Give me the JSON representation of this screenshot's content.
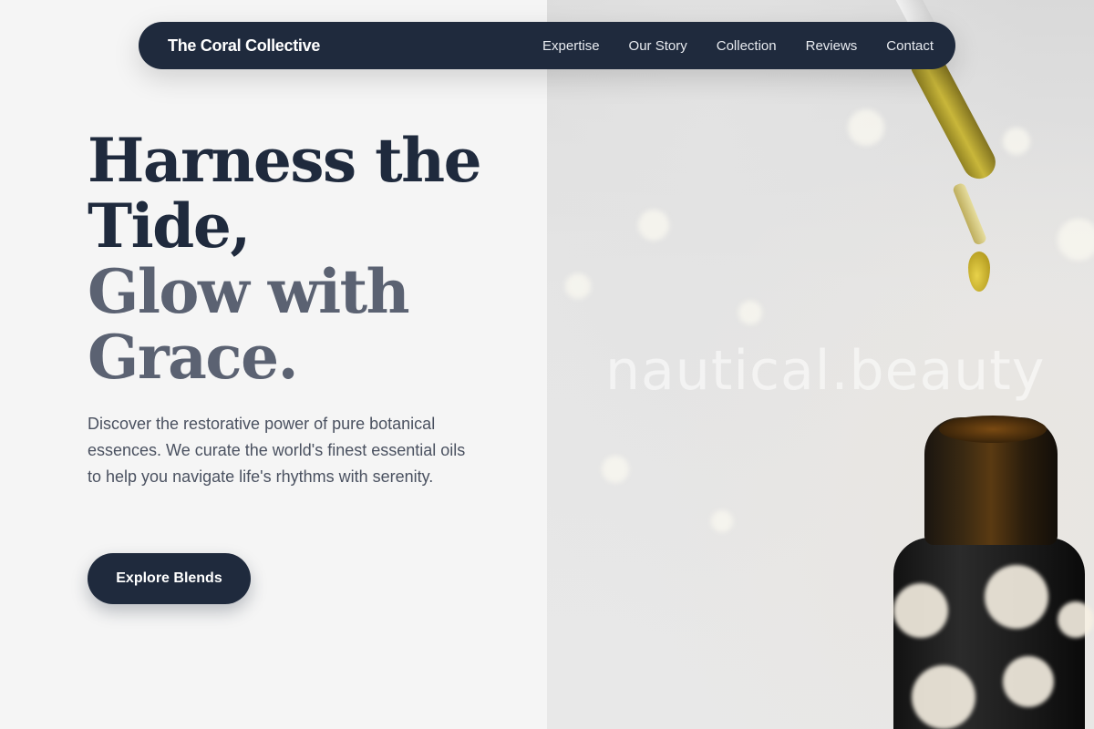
{
  "header": {
    "brand": "The Coral Collective",
    "nav": [
      {
        "label": "Expertise"
      },
      {
        "label": "Our Story"
      },
      {
        "label": "Collection"
      },
      {
        "label": "Reviews"
      },
      {
        "label": "Contact"
      }
    ]
  },
  "hero": {
    "headline_line1": "Harness the",
    "headline_line2": "Tide,",
    "headline_line3": "Glow with",
    "headline_line4": "Grace.",
    "description": "Discover the restorative power of pure botanical essences. We curate the world's finest essential oils to help you navigate life's rhythms with serenity.",
    "cta_label": "Explore Blends",
    "image": {
      "watermark": "nautical.beauty"
    }
  },
  "colors": {
    "navy": "#1f2a3d",
    "muted_heading": "#5b6272",
    "body_text": "#4a5160",
    "background": "#f5f5f5"
  }
}
